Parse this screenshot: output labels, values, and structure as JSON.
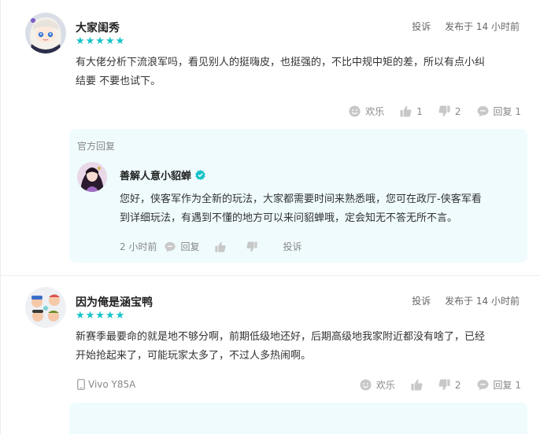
{
  "comments": [
    {
      "username": "大家闺秀",
      "stars": "★★★★★",
      "report_label": "投诉",
      "time": "发布于 14 小时前",
      "content": "有大佬分析下流浪军吗，看见别人的挺嗨皮，也挺强的，不比中规中矩的差，所以有点小纠\n结要 不要也试下。",
      "actions": {
        "joy_label": "欢乐",
        "like_count": "1",
        "dislike_count": "2",
        "reply_label": "回复 1"
      },
      "official_reply": {
        "title": "官方回复",
        "name": "善解人意小貂蝉",
        "content": "您好，侠客军作为全新的玩法，大家都需要时间来熟悉哦，您可在政厅-侠客军看\n到详细玩法，有遇到不懂的地方可以来问貂蝉哦，定会知无不答无所不言。",
        "time": "2 小时前",
        "reply_label": "回复",
        "report_label": "投诉"
      }
    },
    {
      "username": "因为俺是涵宝鸭",
      "stars": "★★★★★",
      "report_label": "投诉",
      "time": "发布于 14 小时前",
      "content": "新赛季最要命的就是地不够分啊，前期低级地还好，后期高级地我家附近都没有啥了，已经\n开始抢起来了，可能玩家太多了，不过人多热闹啊。",
      "device": "Vivo Y85A",
      "actions": {
        "joy_label": "欢乐",
        "dislike_count": "2",
        "reply_label": "回复 1"
      }
    }
  ],
  "colors": {
    "accent": "#14c3c7",
    "reply_bg": "#effbfd",
    "icon": "#c8c8c8"
  }
}
